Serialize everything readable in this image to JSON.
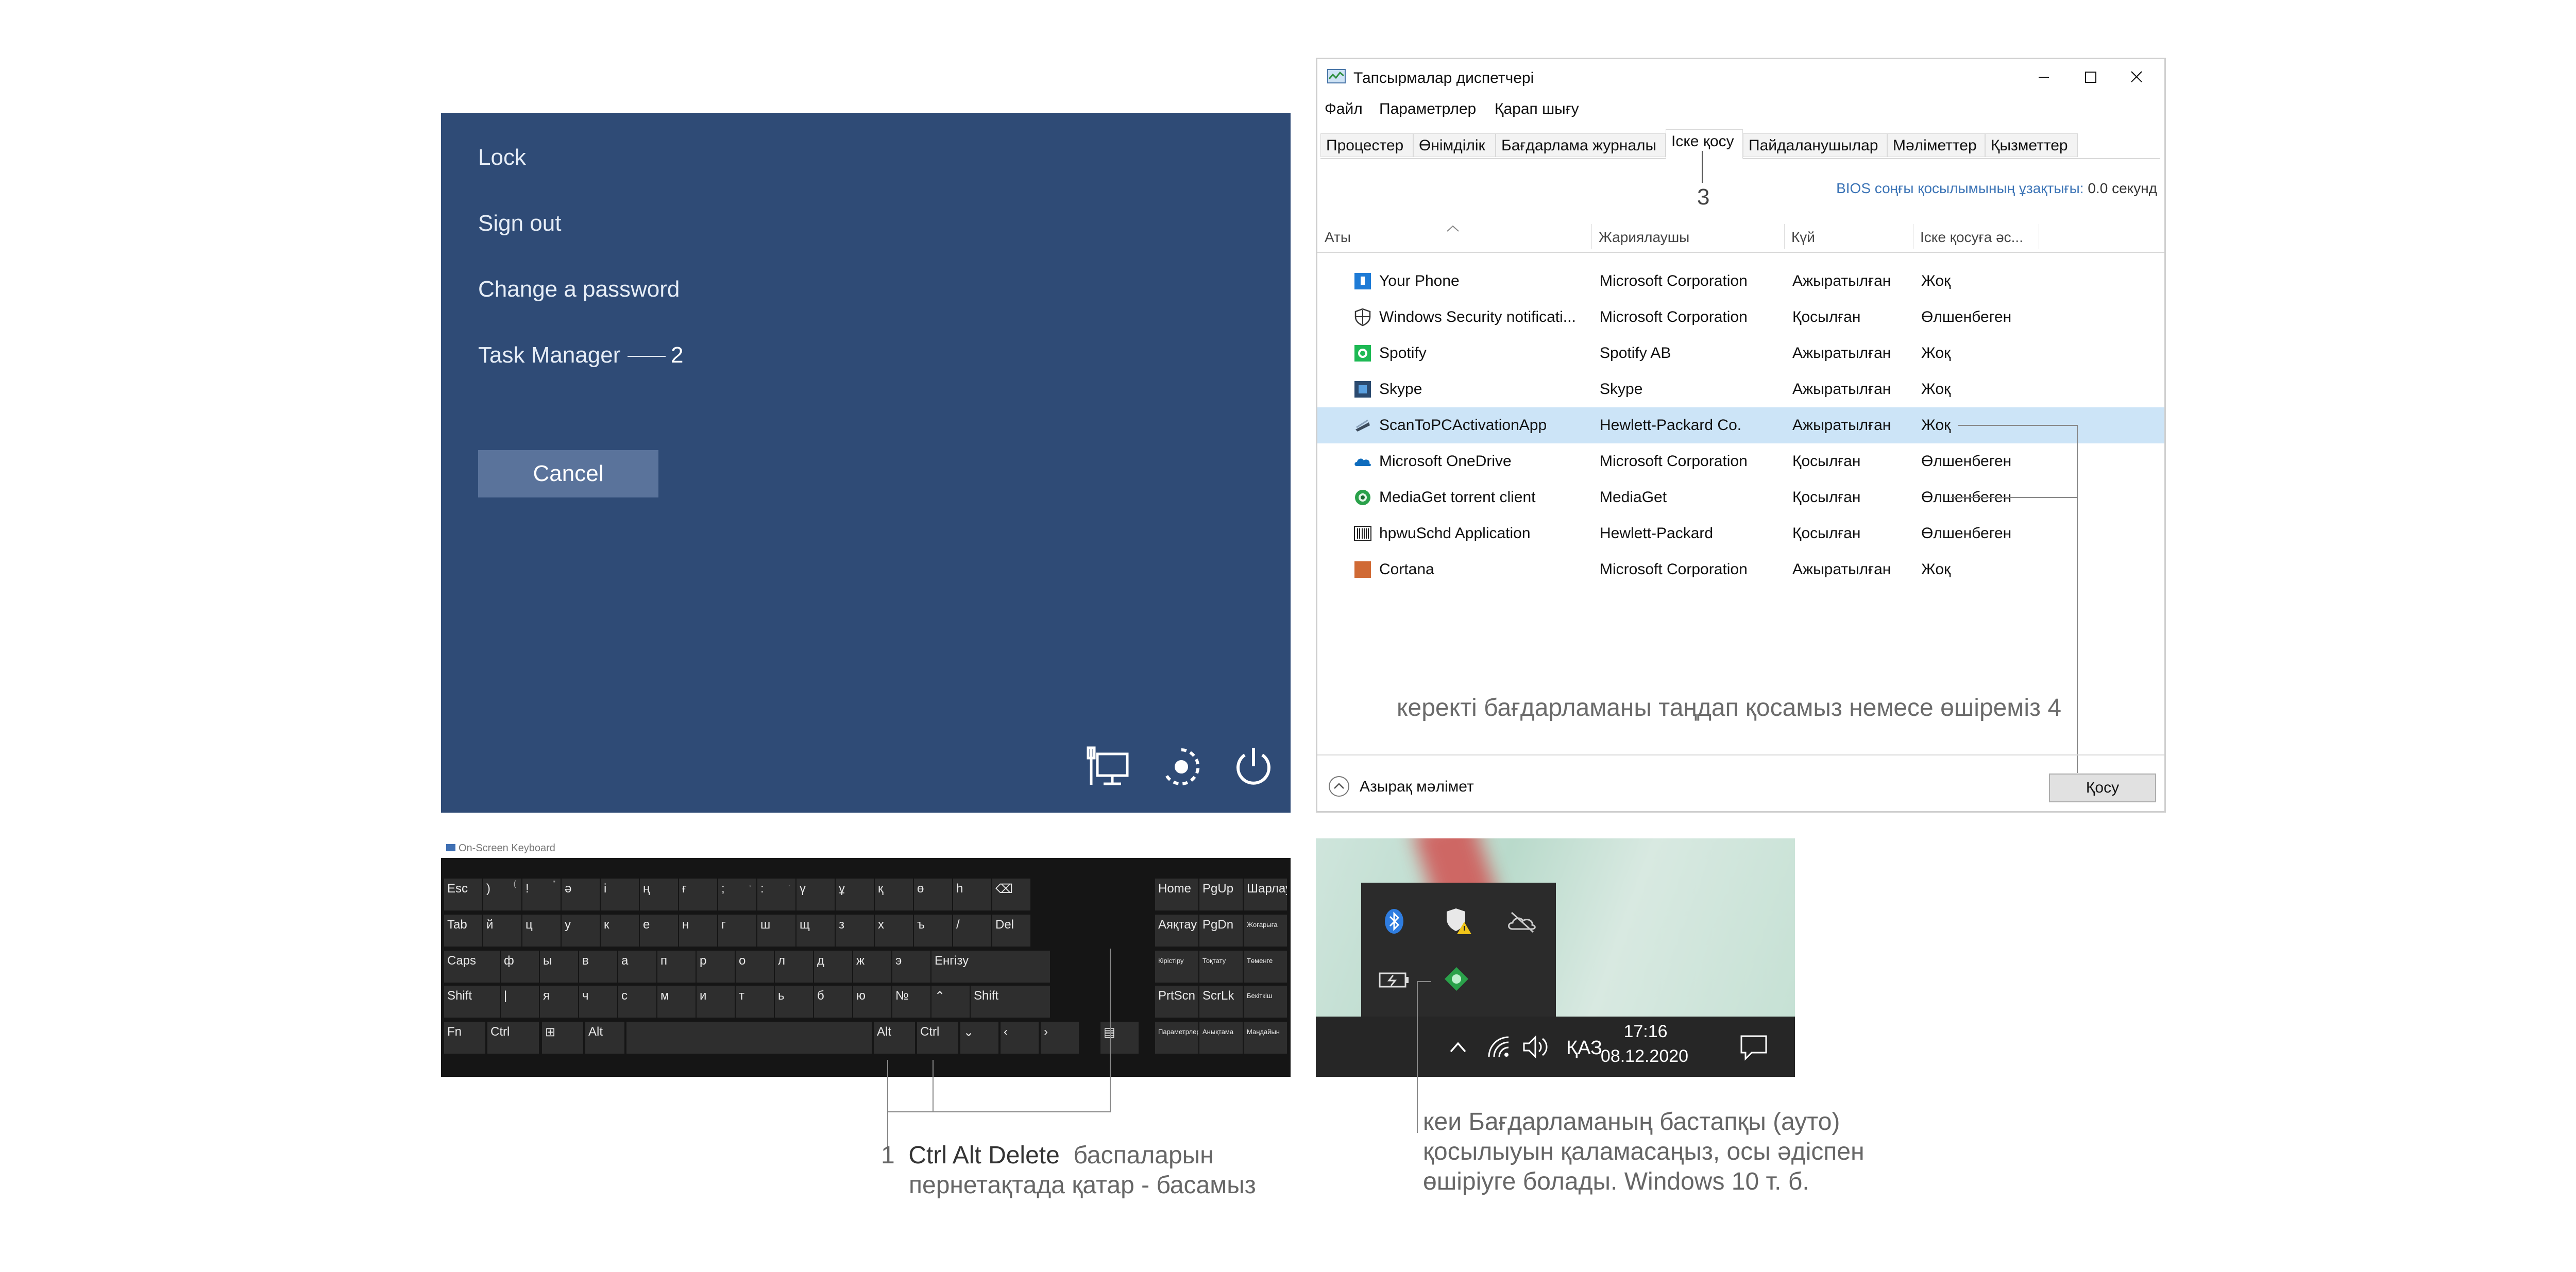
{
  "lock_screen": {
    "options": [
      "Lock",
      "Sign out",
      "Change a password",
      "Task Manager"
    ],
    "step_number": "2",
    "cancel_label": "Cancel",
    "icons": [
      "network-icon",
      "accessibility-icon",
      "power-icon"
    ]
  },
  "task_manager": {
    "title": "Тапсырмалар диспетчері",
    "menu": [
      "Файл",
      "Параметрлер",
      "Қарап шығу"
    ],
    "tabs": [
      "Процестер",
      "Өнімділік",
      "Бағдарлама журналы",
      "Іске қосу",
      "Пайдаланушылар",
      "Мәліметтер",
      "Қызметтер"
    ],
    "active_tab": "Іске қосу",
    "step_number": "3",
    "bios_label": "BIOS соңғы қосылымының ұзақтығы:",
    "bios_value": "0.0 секунд",
    "columns": [
      "Аты",
      "Жариялаушы",
      "Күй",
      "Іске қосуға әс..."
    ],
    "rows": [
      {
        "name": "Your Phone",
        "publisher": "Microsoft Corporation",
        "status": "Ажыратылған",
        "impact": "Жоқ",
        "icon": "your-phone-icon",
        "color": "#1e7bd6"
      },
      {
        "name": "Windows Security notificati...",
        "publisher": "Microsoft Corporation",
        "status": "Қосылған",
        "impact": "Өлшенбеген",
        "icon": "shield-icon",
        "color": "#333333"
      },
      {
        "name": "Spotify",
        "publisher": "Spotify AB",
        "status": "Ажыратылған",
        "impact": "Жоқ",
        "icon": "spotify-icon",
        "color": "#1db954"
      },
      {
        "name": "Skype",
        "publisher": "Skype",
        "status": "Ажыратылған",
        "impact": "Жоқ",
        "icon": "skype-icon",
        "color": "#2b4a6f"
      },
      {
        "name": "ScanToPCActivationApp",
        "publisher": "Hewlett-Packard Co.",
        "status": "Ажыратылған",
        "impact": "Жоқ",
        "icon": "scanner-icon",
        "color": "#3c4b5c"
      },
      {
        "name": "Microsoft OneDrive",
        "publisher": "Microsoft Corporation",
        "status": "Қосылған",
        "impact": "Өлшенбеген",
        "icon": "onedrive-icon",
        "color": "#0f6cbd"
      },
      {
        "name": "MediaGet torrent client",
        "publisher": "MediaGet",
        "status": "Қосылған",
        "impact": "Өлшенбеген",
        "icon": "mediaget-icon",
        "color": "#2aa14a"
      },
      {
        "name": "hpwuSchd Application",
        "publisher": "Hewlett-Packard",
        "status": "Қосылған",
        "impact": "Өлшенбеген",
        "icon": "barcode-icon",
        "color": "#222222"
      },
      {
        "name": "Cortana",
        "publisher": "Microsoft Corporation",
        "status": "Ажыратылған",
        "impact": "Жоқ",
        "icon": "cortana-icon",
        "color": "#d06a35"
      }
    ],
    "selected_row": 4,
    "note": "керекті бағдарламаны таңдап қосамыз немесе өшіреміз 4",
    "fewer_details": "Азырақ мәлімет",
    "enable_button": "Қосу"
  },
  "keyboard": {
    "title": "On-Screen Keyboard",
    "row1": [
      "Esc",
      ")",
      "!",
      "ә",
      "і",
      "ң",
      "ғ",
      ";",
      ":",
      "ү",
      "ұ",
      "қ",
      "ө",
      "һ",
      "⌫"
    ],
    "row1_sub": [
      "",
      "(",
      "\"",
      "",
      "",
      "",
      "",
      ",",
      ".",
      "",
      "",
      "",
      "",
      "",
      ""
    ],
    "row2": [
      "Tab",
      "й",
      "ц",
      "у",
      "к",
      "е",
      "н",
      "г",
      "ш",
      "щ",
      "з",
      "х",
      "ъ",
      "/",
      "Del"
    ],
    "row3": [
      "Caps",
      "ф",
      "ы",
      "в",
      "а",
      "п",
      "р",
      "о",
      "л",
      "д",
      "ж",
      "э",
      "Енгізу"
    ],
    "row4": [
      "Shift",
      "|",
      "я",
      "ч",
      "с",
      "м",
      "и",
      "т",
      "ь",
      "б",
      "ю",
      "№",
      "⌃",
      "Shift"
    ],
    "row5": [
      "Fn",
      "Ctrl",
      "⊞",
      "Alt",
      "",
      "Alt",
      "Ctrl",
      "⌄",
      "‹",
      "›",
      "▤"
    ],
    "nav": [
      "Home",
      "PgUp",
      "Шарлау",
      "Аяқтау",
      "PgDn",
      "Жоғарыға",
      "Кірістіру",
      "Тоқтату",
      "Төменге",
      "PrtScn",
      "ScrLk",
      "Бекіткіш",
      "Параметрлер",
      "Анықтама",
      "Маңдайын"
    ]
  },
  "taskbar": {
    "time": "17:16",
    "date": "08.12.2020",
    "language": "ҚАЗ",
    "tray_icons": [
      "bluetooth-icon",
      "security-warning-icon",
      "cloud-off-icon",
      "battery-icon",
      "mediaget-tray-icon"
    ]
  },
  "captions": {
    "step1_number": "1",
    "step1_keys": "Ctrl  Alt  Delete",
    "step1_rest": "баспаларын",
    "step1_line2": "пернетақтада қатар - басамыз",
    "tray_line1": "кеи Бағдарламаның бастапқы (ауто)",
    "tray_line2": "қосылыуын қаламасаңыз, осы әдіспен",
    "tray_line3": "өшіріуге болады. Windows 10 т. б."
  }
}
